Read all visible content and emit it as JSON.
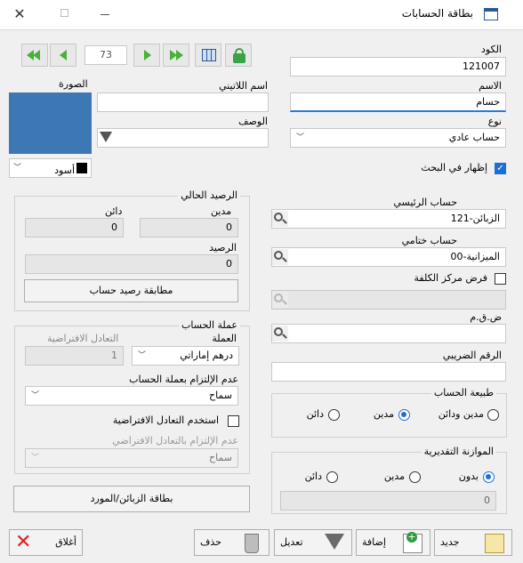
{
  "window": {
    "title": "بطاقة الحسابات"
  },
  "nav": {
    "record_number": "73"
  },
  "fields": {
    "code_label": "الكود",
    "code_value": "121007",
    "name_label": "الاسم",
    "name_value": "حسام",
    "latin_name_label": "اسم اللاتيني",
    "latin_name_value": "",
    "description_label": "الوصف",
    "description_value": "",
    "type_label": "نوع",
    "type_value": "حساب عادي",
    "image_label": "الصورة",
    "color_value": "أسود",
    "show_in_search_label": "إظهار في البحث",
    "parent_account_label": "حساب الرئيسي",
    "parent_account_value": "121-الزبائن",
    "final_account_label": "حساب ختامي",
    "final_account_value": "00-الميزانية",
    "cost_center_label": "فرض مركز الكلفة",
    "cost_center_value": "",
    "vat_label": "ض.ق.م",
    "vat_value": "",
    "tax_number_label": "الرقم الضريبي",
    "tax_number_value": ""
  },
  "balance": {
    "title": "الرصيد الحالي",
    "debit_label": "مدين",
    "credit_label": "دائن",
    "debit_value": "0",
    "credit_value": "0",
    "balance_label": "الرصيد",
    "balance_value": "0",
    "match_button": "مطابقة رصيد حساب"
  },
  "currency": {
    "title": "عملة الحساب",
    "currency_label": "العملة",
    "currency_value": "درهم إماراتي",
    "default_rate_label": "التعادل الافتراضية",
    "default_rate_value": "1",
    "commitment_label": "عدم الإلتزام بعملة الحساب",
    "commitment_value": "سماح",
    "use_default_rate_label": "استخدم التعادل الافتراضية",
    "default_commitment_label": "عدم الإلتزام بالتعادل الافتراضي",
    "default_commitment_value": "سماح"
  },
  "nature": {
    "title": "طبيعة الحساب",
    "options": [
      "مدين ودائن",
      "مدين",
      "دائن"
    ]
  },
  "budget": {
    "title": "الموازنة التقديرية",
    "options": [
      "بدون",
      "مدين",
      "دائن"
    ],
    "value": "0"
  },
  "customer_card_button": "بطاقة الزبائن/المورد",
  "footer": {
    "new": "جديد",
    "add": "إضافة",
    "edit": "تعديل",
    "delete": "حذف",
    "close": "أغلاق"
  },
  "colors": {
    "accent": "#1f6fd1",
    "image_bg": "#3d78b4",
    "nav_green": "#4caf3a"
  }
}
